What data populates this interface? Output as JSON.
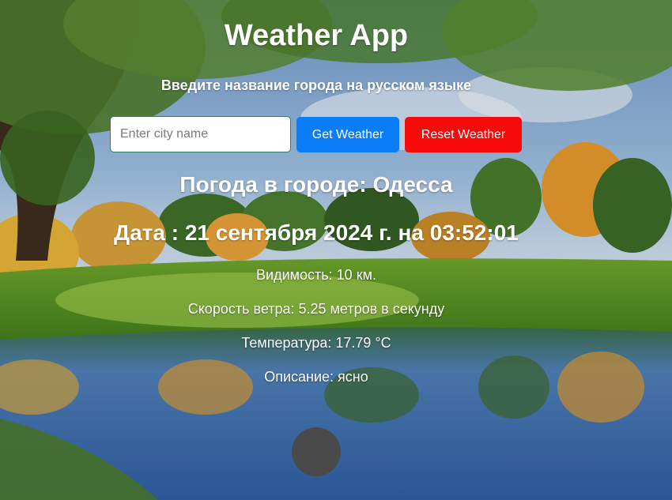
{
  "app": {
    "title": "Weather App",
    "subtitle": "Введите название города на русском языке"
  },
  "search": {
    "value": "",
    "placeholder": "Enter city name",
    "get_button": "Get Weather",
    "reset_button": "Reset Weather"
  },
  "weather": {
    "city_heading": "Погода в городе: Одесса",
    "date_heading": "Дата : 21 сентября 2024 г. на 03:52:01",
    "visibility": "Видимость: 10 км.",
    "wind": "Скорость ветра: 5.25 метров в секунду",
    "temperature": "Температура: 17.79 °C",
    "description": "Описание: ясно"
  },
  "colors": {
    "get_button": "#0a7df9",
    "reset_button": "#f80a0a",
    "text": "#ffffff"
  }
}
